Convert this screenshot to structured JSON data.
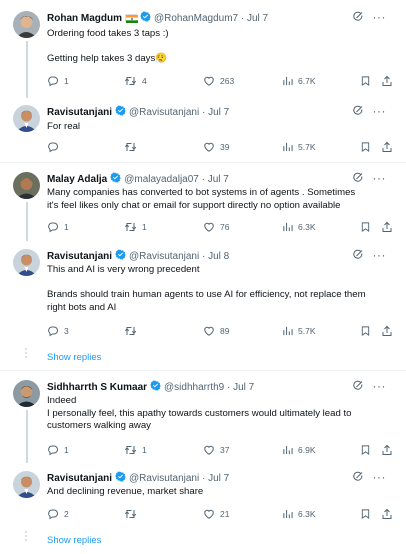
{
  "tweets": [
    {
      "name": "Rohan Magdum",
      "handle": "@RohanMagdum7 · Jul 7",
      "lines": [
        "Ordering food takes 3 taps :)",
        "",
        "Getting help takes 3 days😮‍💨"
      ],
      "replies": "1",
      "retweets": "4",
      "likes": "263",
      "views": "6.7K"
    },
    {
      "name": "Ravisutanjani",
      "handle": "@Ravisutanjani · Jul 7",
      "lines": [
        "For real"
      ],
      "replies": "",
      "retweets": "",
      "likes": "39",
      "views": "5.7K"
    },
    {
      "name": "Malay Adalja",
      "handle": "@malayadalja07 · Jul 7",
      "lines": [
        "Many  companies has converted to bot systems in of agents . Sometimes",
        "it's feel likes only chat or email for support directly no option available"
      ],
      "replies": "1",
      "retweets": "1",
      "likes": "76",
      "views": "6.3K"
    },
    {
      "name": "Ravisutanjani",
      "handle": "@Ravisutanjani · Jul 8",
      "lines": [
        "This and AI is very wrong precedent",
        "",
        "Brands should train human agents to use AI for efficiency, not replace them",
        "right bots and AI"
      ],
      "replies": "3",
      "retweets": "",
      "likes": "89",
      "views": "5.7K"
    },
    {
      "name": "Sidhharrth S Kumaar",
      "handle": "@sidhharrth9 · Jul 7",
      "lines": [
        "Indeed",
        "I personally feel, this apathy towards customers would ultimately lead to",
        "customers walking away"
      ],
      "replies": "1",
      "retweets": "1",
      "likes": "37",
      "views": "6.9K"
    },
    {
      "name": "Ravisutanjani",
      "handle": "@Ravisutanjani · Jul 7",
      "lines": [
        "And declining revenue, market share"
      ],
      "replies": "2",
      "retweets": "",
      "likes": "21",
      "views": "6.3K"
    }
  ],
  "show_replies_label": "Show replies",
  "colors": {
    "text": "#0f1419",
    "secondary": "#536471",
    "link": "#1d9bf0",
    "verified": "#1d9bf0",
    "divider": "#eff3f4",
    "thread_line": "#cfd9de"
  },
  "icons": {
    "reply": "reply-icon",
    "retweet": "retweet-icon",
    "like": "heart-icon",
    "views": "views-icon",
    "bookmark": "bookmark-icon",
    "share": "share-icon",
    "grok": "grok-icon",
    "more": "more-icon",
    "verified": "verified-badge-icon",
    "flag": "india-flag-icon"
  }
}
